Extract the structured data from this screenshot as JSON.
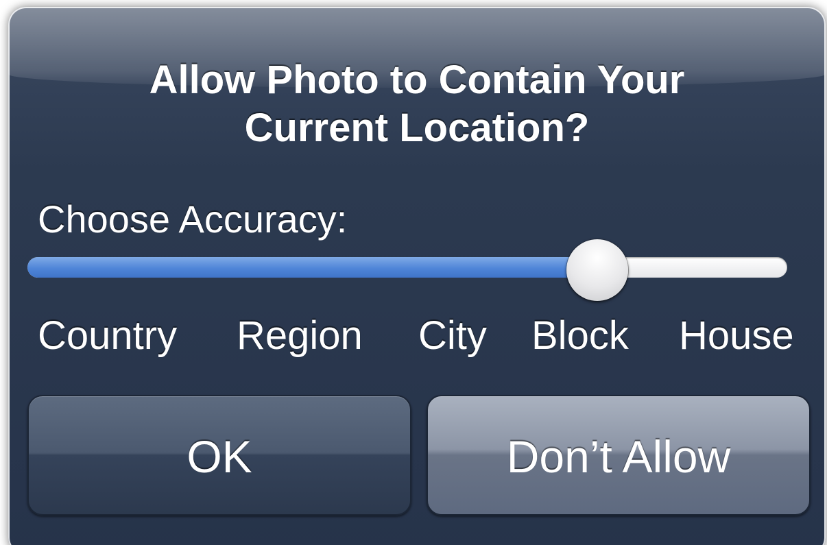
{
  "alert": {
    "title_line1": "Allow Photo to Contain Your",
    "title_line2": "Current Location?",
    "accuracy_label": "Choose Accuracy:",
    "slider": {
      "levels": [
        "Country",
        "Region",
        "City",
        "Block",
        "House"
      ],
      "value_fraction": 0.75,
      "fill_color": "#4f85d8"
    },
    "buttons": {
      "ok_label": "OK",
      "deny_label": "Don’t Allow"
    }
  }
}
